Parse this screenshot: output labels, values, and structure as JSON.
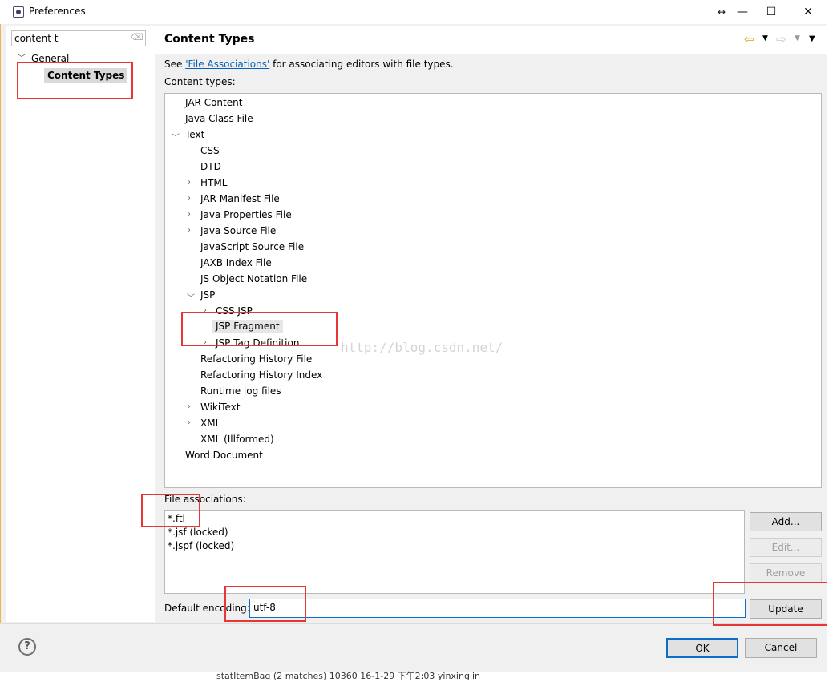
{
  "window": {
    "title": "Preferences"
  },
  "left_pane": {
    "filter_value": "content t",
    "tree": [
      {
        "label": "General",
        "expanded": true
      },
      {
        "label": "Content Types",
        "selected": true
      }
    ]
  },
  "page": {
    "title": "Content Types",
    "see_prefix": "See ",
    "see_link": "'File Associations'",
    "see_suffix": " for associating editors with file types.",
    "content_types_label": "Content types:",
    "content_types": [
      "JAR Content",
      "Java Class File",
      "Text",
      "CSS",
      "DTD",
      "HTML",
      "JAR Manifest File",
      "Java Properties File",
      "Java Source File",
      "JavaScript Source File",
      "JAXB Index File",
      "JS Object Notation File",
      "JSP",
      "CSS JSP",
      "JSP Fragment",
      "JSP Tag Definition",
      "Refactoring History File",
      "Refactoring History Index",
      "Runtime log files",
      "WikiText",
      "XML",
      "XML (Illformed)",
      "Word Document"
    ],
    "file_assoc_label": "File associations:",
    "file_associations": [
      "*.ftl",
      "*.jsf (locked)",
      "*.jspf (locked)"
    ],
    "buttons": {
      "add": "Add...",
      "edit": "Edit...",
      "remove": "Remove",
      "update": "Update"
    },
    "encoding_label": "Default encoding:",
    "encoding_value": "utf-8"
  },
  "footer": {
    "ok": "OK",
    "cancel": "Cancel",
    "help": "?"
  },
  "watermark": "http://blog.csdn.net/",
  "background_text": "statItemBag (2 matches) 10360 16-1-29 下午2:03 yinxinglin"
}
